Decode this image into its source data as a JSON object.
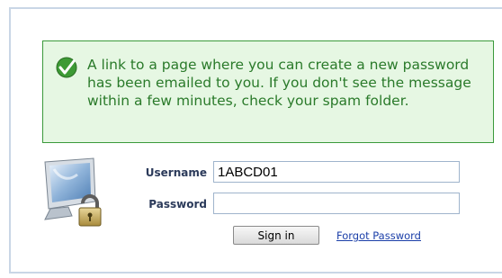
{
  "notice": {
    "message": "A link to a page where you can create a new password has been emailed to you. If you don't see the message within a few minutes, check your spam folder.",
    "icon": "checkmark-icon",
    "colors": {
      "border": "#3b9a3b",
      "background": "#e6f7e3",
      "text": "#2a7a2a"
    }
  },
  "login": {
    "icon": "computer-lock-icon",
    "username_label": "Username",
    "username_value": "1ABCD01",
    "password_label": "Password",
    "password_value": "",
    "signin_label": "Sign in",
    "forgot_label": "Forgot Password"
  }
}
